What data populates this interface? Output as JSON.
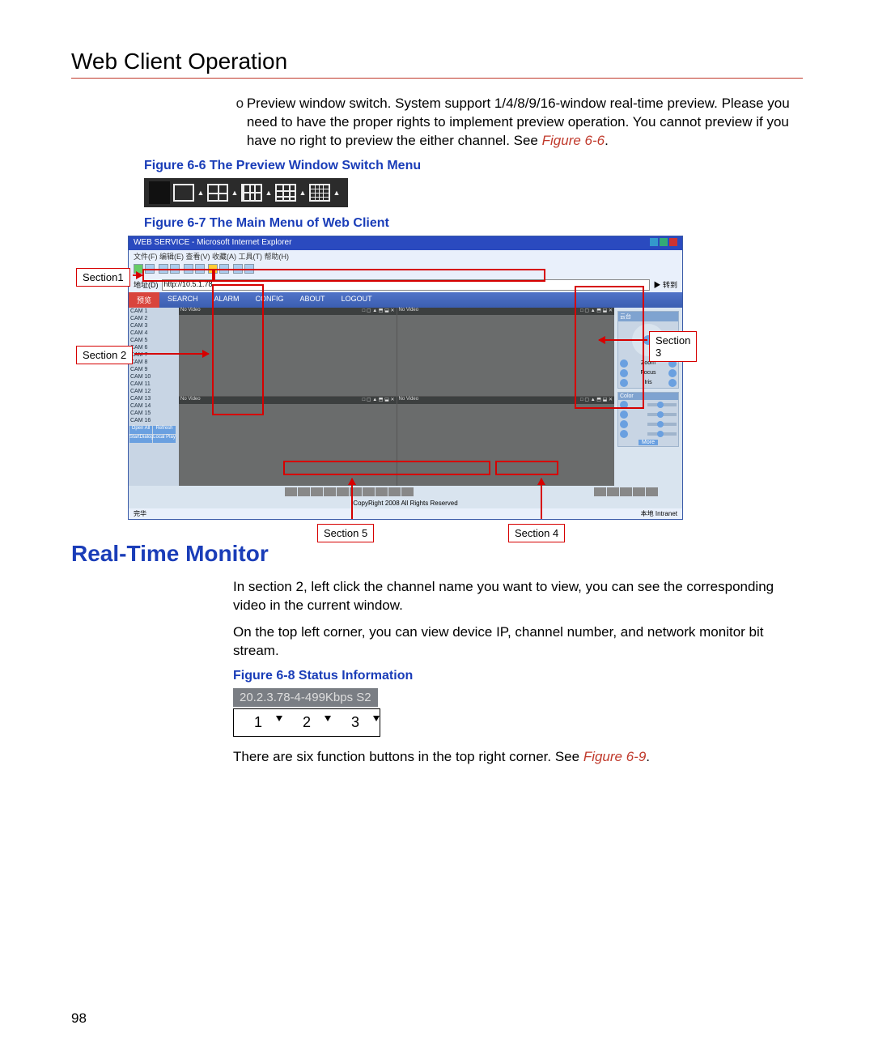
{
  "page_title": "Web Client Operation",
  "bullet_mark": "o",
  "bullet_text_a": "Preview window switch. System support 1/4/8/9/16-window real-time preview. Please you need to have the proper rights to implement preview operation. You cannot preview if you have no right to preview the either channel. See ",
  "bullet_ref_a": "Figure 6-6",
  "bullet_tail_a": ".",
  "fig66_caption": "Figure 6-6 The Preview Window Switch Menu",
  "fig67_caption": "Figure 6-7 The Main Menu of Web Client",
  "browser": {
    "title": "WEB SERVICE - Microsoft Internet Explorer",
    "menu": "文件(F)  编辑(E)  查看(V)  收藏(A)  工具(T)  帮助(H)",
    "addr_label": "地址(D)",
    "addr_value": "http://10.5.1.78",
    "go_label": "▶ 转到",
    "status_left": "完华",
    "status_right": "本地 Intranet",
    "app_tabs": [
      "预览",
      "SEARCH",
      "ALARM",
      "CONFIG",
      "ABOUT",
      "LOGOUT"
    ],
    "cam_items": [
      "CAM 1",
      "CAM 2",
      "CAM 3",
      "CAM 4",
      "CAM 5",
      "CAM 6",
      "CAM 7",
      "CAM 8",
      "CAM 9",
      "CAM 10",
      "CAM 11",
      "CAM 12",
      "CAM 13",
      "CAM 14",
      "CAM 15",
      "CAM 16"
    ],
    "cam_btns": [
      "Open All",
      "Refresh",
      "StartDialog",
      "Local Play"
    ],
    "video_hdr_left": "No Video",
    "video_hdr_right": "□ ▢ ▲ ⬒ ⬓ ✕",
    "side": {
      "ptz": "云台",
      "zoom": "Zoom",
      "focus": "Focus",
      "iris": "Iris",
      "color": "Color",
      "more": "More"
    },
    "copyright": "CopyRight 2008 All Rights Reserved"
  },
  "labels": {
    "s1": "Section1",
    "s2": "Section 2",
    "s3": "Section 3",
    "s4": "Section 4",
    "s5": "Section 5"
  },
  "section_heading": "Real-Time Monitor",
  "para1": "In section 2, left click the channel name you want to view, you can see the corresponding video in the current window.",
  "para2": "On the top left corner, you can view device IP, channel number, and network monitor bit stream.",
  "fig68_caption": "Figure 6-8 Status Information",
  "status_text": "20.2.3.78-4-499Kbps S2",
  "nums": [
    "1",
    "2",
    "3"
  ],
  "para3_a": "There are six function buttons in the top right corner. See ",
  "para3_ref": "Figure 6-9",
  "para3_tail": ".",
  "page_number": "98"
}
